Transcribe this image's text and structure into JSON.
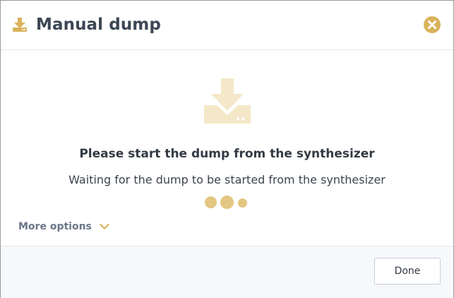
{
  "dialog": {
    "title": "Manual dump",
    "title_icon": "download-icon",
    "close_icon": "close-icon"
  },
  "body": {
    "illustration_icon": "download-to-drive-icon",
    "heading": "Please start the dump from the synthesizer",
    "status_text": "Waiting for the dump to be started from the synthesizer",
    "loading_indicator": "loading-dots-icon",
    "more_options_label": "More options",
    "more_options_icon": "chevron-down-icon"
  },
  "footer": {
    "done_label": "Done"
  },
  "colors": {
    "accent": "#d9b35b",
    "accent_light": "#f4e8c8",
    "loading_dot": "#e3c681",
    "title_text": "#3c4654",
    "muted_text": "#6b7689",
    "footer_bg": "#f6f8fb"
  }
}
